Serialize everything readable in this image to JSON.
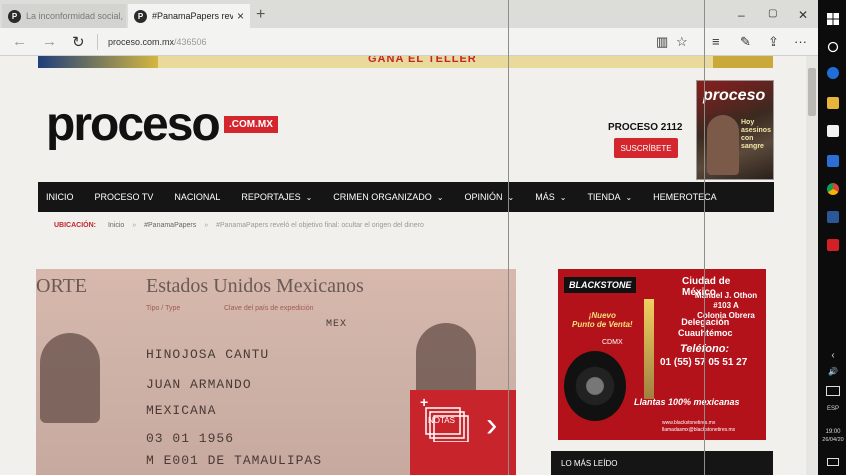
{
  "browser": {
    "tabs": [
      {
        "favicon": "P",
        "title": "La inconformidad social, se"
      },
      {
        "favicon": "P",
        "title": "#PanamaPapers reveló ‹",
        "close": "×"
      }
    ],
    "new_tab": "+",
    "window_controls": {
      "minimize": "–",
      "maximize": "▢",
      "close": "✕"
    },
    "nav": {
      "back": "←",
      "forward": "→",
      "refresh": "↻"
    },
    "url": {
      "host": "proceso.com.mx",
      "path": "/436506"
    },
    "tools": {
      "reading_view": "▥",
      "favorite": "☆",
      "hub": "≡",
      "notes": "✎",
      "share": "⇪",
      "more": "···"
    }
  },
  "site": {
    "banner_text": "GANA EL TELLER",
    "logo": "proceso",
    "logo_badge": ".COM.MX",
    "edition": "PROCESO 2112",
    "subscribe": "SUSCRÍBETE",
    "cover": {
      "title": "proceso",
      "headline": "Hoy asesinos con sangre"
    }
  },
  "nav": {
    "items": [
      {
        "label": "INICIO",
        "caret": ""
      },
      {
        "label": "PROCESO TV",
        "caret": ""
      },
      {
        "label": "NACIONAL",
        "caret": ""
      },
      {
        "label": "REPORTAJES",
        "caret": "⌄"
      },
      {
        "label": "CRIMEN ORGANIZADO",
        "caret": "⌄"
      },
      {
        "label": "OPINIÓN",
        "caret": "⌄"
      },
      {
        "label": "MÁS",
        "caret": "⌄"
      },
      {
        "label": "TIENDA",
        "caret": "⌄"
      },
      {
        "label": "HEMEROTECA",
        "caret": ""
      }
    ]
  },
  "breadcrumb": {
    "label": "UBICACIÓN:",
    "sep": "»",
    "items": [
      "Inicio",
      "#PanamaPapers",
      "#PanamaPapers reveló el objetivo final: ocultar el origen del dinero"
    ]
  },
  "feature": {
    "doc_header": "ORTE",
    "doc_country": "Estados Unidos Mexicanos",
    "doc_small_1": "Tipo / Type",
    "doc_small_2": "Clave del país de expedición",
    "doc_small_3": "MEX",
    "doc_surname": "HINOJOSA CANTU",
    "doc_names": "JUAN ARMANDO",
    "doc_nationality": "MEXICANA",
    "doc_birth": "03 01 1956",
    "doc_bottom": "M          E001 DE TAMAULIPAS",
    "notas_plus": "+",
    "notas_label": "NOTAS",
    "notas_chevron": "›"
  },
  "ad": {
    "brand": "BLACKSTONE",
    "city": "Ciudad de México",
    "address": [
      "Manuel J. Othon #103 A",
      "Colonia Obrera"
    ],
    "nuevo": [
      "¡Nuevo",
      "Punto de Venta!"
    ],
    "cdmx": "CDMX",
    "delegacion": [
      "Delegación",
      "Cuauhtémoc"
    ],
    "tel_label": "Teléfono:",
    "phone": "01 (55) 57 05 51 27",
    "slogan": "Llantas 100% mexicanas",
    "web": [
      "www.blackstonetires.mx",
      "llamadasmx@blackstonetires.mx"
    ]
  },
  "sidebar": {
    "most_read": "LO MÁS LEÍDO"
  },
  "taskbar": {
    "lang": "ESP",
    "time": "19:00",
    "date": "26/04/20",
    "chevron": "‹",
    "volume": "🔊"
  }
}
